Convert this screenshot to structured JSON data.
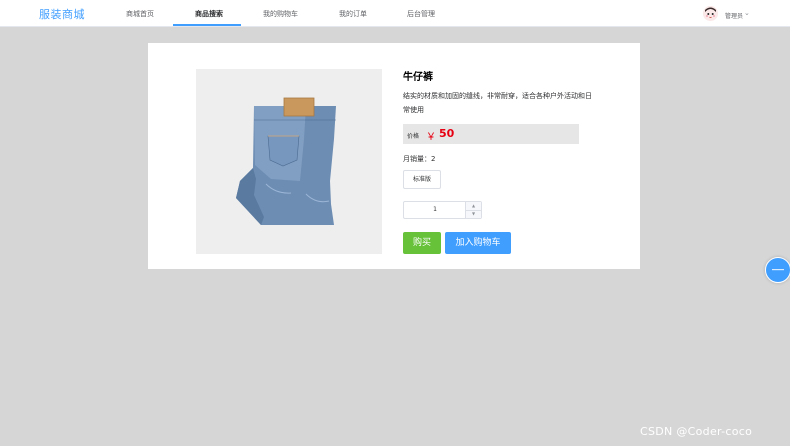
{
  "brand": "服装商城",
  "nav": {
    "items": [
      {
        "label": "商城首页"
      },
      {
        "label": "商品搜索"
      },
      {
        "label": "我的购物车"
      },
      {
        "label": "我的订单"
      },
      {
        "label": "后台管理"
      }
    ]
  },
  "user": {
    "name": "管理员"
  },
  "product": {
    "title": "牛仔裤",
    "description": "结实的材质和加固的缝线，非常耐穿，适合各种户外活动和日常使用",
    "price_label": "价格",
    "currency": "￥",
    "price": "50",
    "sales_label": "月销量：",
    "sales_value": "2",
    "spec_option": "标准版",
    "quantity": "1",
    "buy_label": "购买",
    "cart_label": "加入购物车"
  },
  "watermark": "CSDN @Coder-coco",
  "colors": {
    "accent": "#409eff",
    "buy": "#67c23a",
    "price": "#e60012",
    "background": "#d6d6d6"
  }
}
